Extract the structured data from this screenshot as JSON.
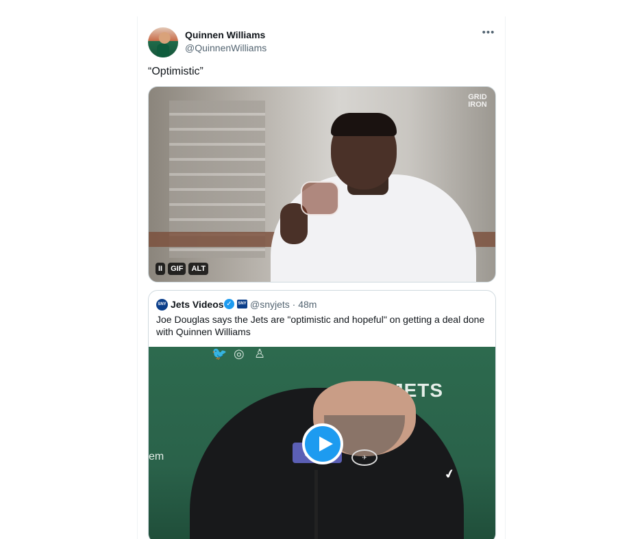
{
  "tweet": {
    "author_name": "Quinnen Williams",
    "author_handle": "@QuinnenWilliams",
    "more_icon": "more-horizontal-icon",
    "text": "“Optimistic”",
    "media": {
      "type": "gif",
      "watermark": "GRID IRON",
      "controls": [
        "II",
        "GIF",
        "ALT"
      ]
    }
  },
  "quoted": {
    "author_name": "Jets Videos",
    "avatar_text": "SNY",
    "badge_text": "SNY",
    "handle_time": "@snyjets · 48m",
    "text": "Joe Douglas says the Jets are \"optimistic and hopeful\" on getting a deal done with Quinnen Williams",
    "video": {
      "backdrop_text": "JETS",
      "side_text": "em",
      "podium_text": "SNY",
      "play_icon": "play-icon"
    }
  },
  "colors": {
    "accent": "#1d9bf0",
    "muted_text": "#536471",
    "border": "#cfd9de"
  }
}
